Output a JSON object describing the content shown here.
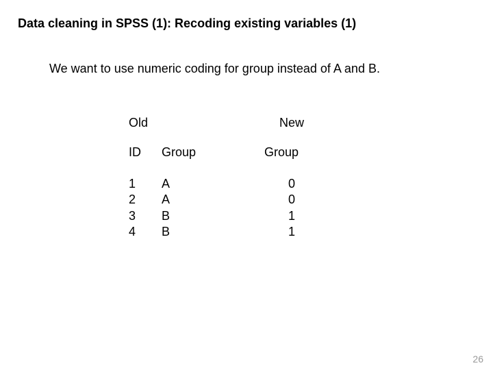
{
  "title": "Data cleaning in SPSS (1): Recoding existing variables (1)",
  "subtitle": "We want to use numeric coding for group instead of A and B.",
  "headers": {
    "old": "Old",
    "new": "New",
    "id": "ID",
    "group_old": "Group",
    "group_new": "Group"
  },
  "rows": [
    {
      "id": "1",
      "old_group": "A",
      "new_group": "0"
    },
    {
      "id": "2",
      "old_group": "A",
      "new_group": "0"
    },
    {
      "id": "3",
      "old_group": "B",
      "new_group": "1"
    },
    {
      "id": "4",
      "old_group": "B",
      "new_group": "1"
    }
  ],
  "page_number": "26"
}
